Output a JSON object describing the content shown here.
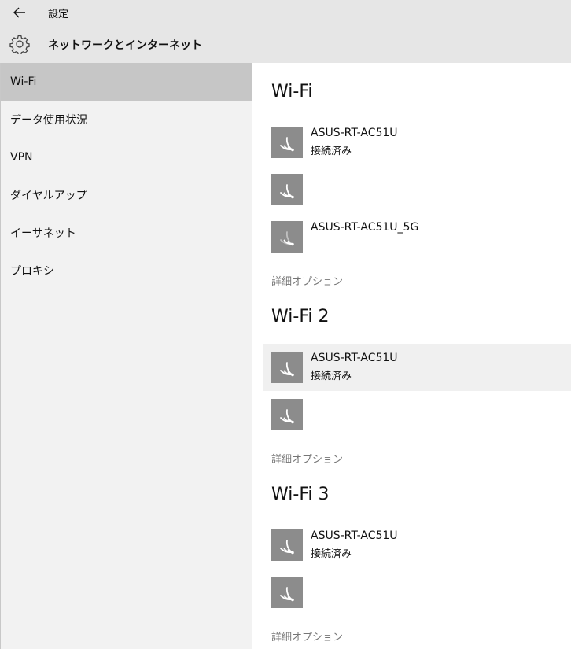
{
  "titlebar": {
    "title": "設定",
    "back_icon": "back-arrow-icon"
  },
  "header": {
    "title": "ネットワークとインターネット",
    "icon": "gear-icon"
  },
  "sidebar": {
    "items": [
      {
        "label": "Wi-Fi",
        "selected": true
      },
      {
        "label": "データ使用状況",
        "selected": false
      },
      {
        "label": "VPN",
        "selected": false
      },
      {
        "label": "ダイヤルアップ",
        "selected": false
      },
      {
        "label": "イーサネット",
        "selected": false
      },
      {
        "label": "プロキシ",
        "selected": false
      }
    ]
  },
  "sections": [
    {
      "title": "Wi-Fi",
      "networks": [
        {
          "name": "ASUS-RT-AC51U",
          "status": "接続済み"
        },
        {
          "name": "",
          "status": ""
        },
        {
          "name": "ASUS-RT-AC51U_5G",
          "status": ""
        }
      ],
      "advanced_label": "詳細オプション"
    },
    {
      "title": "Wi-Fi 2",
      "networks": [
        {
          "name": "ASUS-RT-AC51U",
          "status": "接続済み",
          "highlighted": true
        },
        {
          "name": "",
          "status": ""
        }
      ],
      "advanced_label": "詳細オプション"
    },
    {
      "title": "Wi-Fi 3",
      "networks": [
        {
          "name": "ASUS-RT-AC51U",
          "status": "接続済み"
        },
        {
          "name": "",
          "status": ""
        }
      ],
      "advanced_label": "詳細オプション"
    }
  ],
  "colors": {
    "header_bg": "#e6e6e6",
    "sidebar_bg": "#f2f2f2",
    "selected_bg": "#c6c6c6",
    "wifi_tile": "#8c8c8c",
    "link_gray": "#767676"
  }
}
